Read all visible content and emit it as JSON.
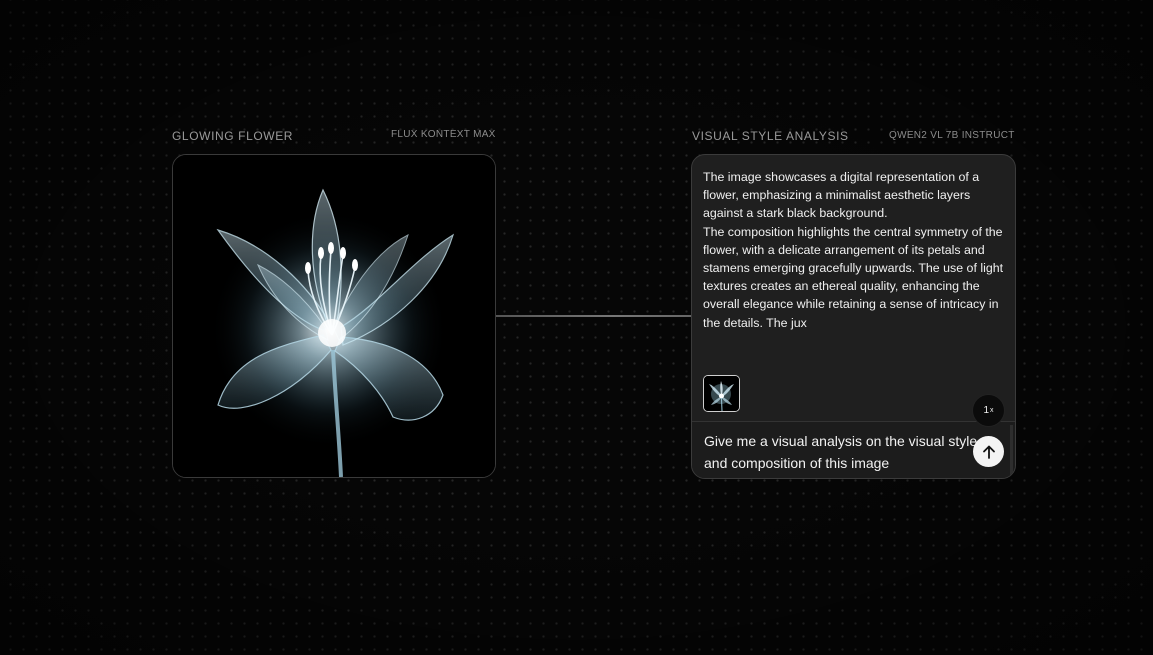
{
  "image_node": {
    "title": "GLOWING FLOWER",
    "model": "FLUX KONTEXT MAX",
    "image_icon": "xray-lily-flower-image"
  },
  "analysis_node": {
    "title": "VISUAL STYLE ANALYSIS",
    "model": "QWEN2 VL 7B INSTRUCT",
    "response_paragraph_1": "The image showcases a digital representation of a flower, emphasizing a minimalist aesthetic layers against a stark black background.",
    "response_paragraph_2": "The composition highlights the central symmetry of the flower, with a delicate arrangement of its petals and stamens emerging gracefully upwards. The use of light textures creates an ethereal quality, enhancing the overall elegance while retaining a sense of intricacy in the details. The jux",
    "attachment_icon": "flower-thumbnail-icon",
    "prompt": "Give me a visual analysis on the visual style and composition of this image",
    "count_value": "1",
    "count_suffix": "x",
    "send_icon": "arrow-up-icon"
  },
  "colors": {
    "background": "#060606",
    "panel": "#1f1f1f",
    "send_button": "#f4f4f4"
  }
}
